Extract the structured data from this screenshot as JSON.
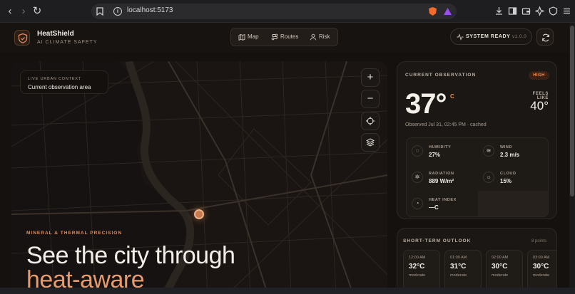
{
  "browser": {
    "url": "localhost:5173"
  },
  "header": {
    "brand": "HeatShield",
    "tagline": "AI CLIMATE SAFETY",
    "nav": [
      {
        "label": "Map",
        "icon": "map-icon"
      },
      {
        "label": "Routes",
        "icon": "routes-icon"
      },
      {
        "label": "Risk",
        "icon": "user-icon"
      }
    ],
    "status_label": "SYSTEM READY",
    "version": "v1.0.0"
  },
  "map": {
    "context_label": "LIVE URBAN CONTEXT",
    "context_value": "Current observation area",
    "zoom_in": "+",
    "zoom_out": "−",
    "eyebrow": "MINERAL & THERMAL PRECISION",
    "hero_line1": "See the city through",
    "hero_line2": "heat-aware"
  },
  "observation": {
    "title": "CURRENT OBSERVATION",
    "badge": "HIGH",
    "temperature": "37°",
    "unit": "C",
    "feels_like_label": "FEELS LIKE",
    "feels_like_value": "40°",
    "observed": "Observed Jul 31, 02:45 PM · cached",
    "metrics": [
      {
        "label": "HUMIDITY",
        "value": "27%",
        "icon": "humidity-icon"
      },
      {
        "label": "WIND",
        "value": "2.3 m/s",
        "icon": "wind-icon"
      },
      {
        "label": "RADIATION",
        "value": "889 W/m²",
        "icon": "radiation-icon"
      },
      {
        "label": "CLOUD",
        "value": "15%",
        "icon": "cloud-icon"
      },
      {
        "label": "HEAT INDEX",
        "value": "—C",
        "icon": "gauge-icon"
      }
    ]
  },
  "outlook": {
    "title": "SHORT-TERM OUTLOOK",
    "points": "8 points",
    "hours": [
      {
        "time": "12:00 AM",
        "temp": "32°C",
        "level": "moderate"
      },
      {
        "time": "01:00 AM",
        "temp": "31°C",
        "level": "moderate"
      },
      {
        "time": "02:00 AM",
        "temp": "30°C",
        "level": "moderate"
      },
      {
        "time": "03:00 AM",
        "temp": "30°C",
        "level": "moderate"
      }
    ]
  },
  "colors": {
    "accent": "#e38a5a",
    "badge_bg": "#3b2114",
    "background": "#14110f"
  }
}
